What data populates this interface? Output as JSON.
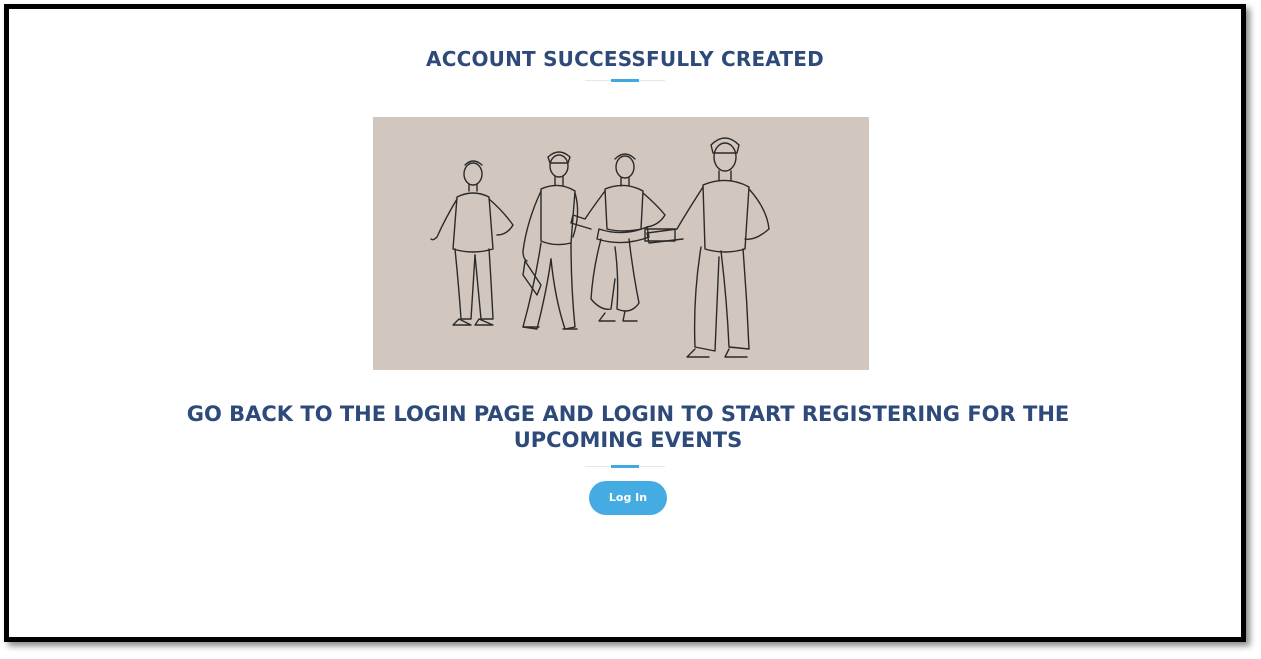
{
  "page": {
    "title": "ACCOUNT SUCCESSFULLY CREATED",
    "message": "GO BACK TO THE LOGIN PAGE AND LOGIN TO START REGISTERING FOR THE UPCOMING EVENTS",
    "login_button": "Log In"
  },
  "colors": {
    "heading": "#2e4a7a",
    "accent": "#3fa9e0",
    "button": "#45ace3",
    "image_background": "#cfc4bc"
  }
}
